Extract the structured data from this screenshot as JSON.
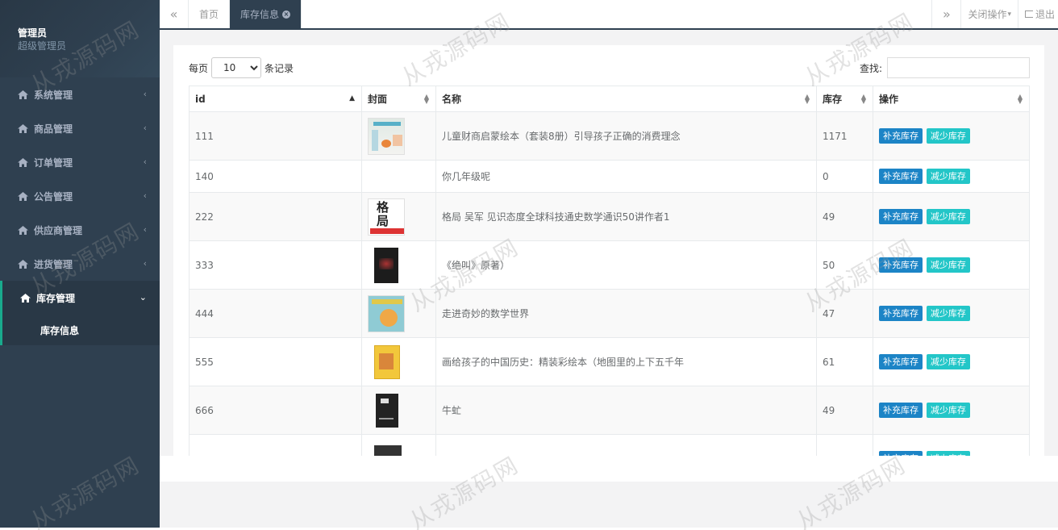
{
  "sidebar": {
    "user_name": "管理员",
    "user_role": "超级管理员",
    "menu": [
      {
        "label": "系统管理",
        "chevron": "‹"
      },
      {
        "label": "商品管理",
        "chevron": "‹"
      },
      {
        "label": "订单管理",
        "chevron": "‹"
      },
      {
        "label": "公告管理",
        "chevron": "‹"
      },
      {
        "label": "供应商管理",
        "chevron": "‹"
      },
      {
        "label": "进货管理",
        "chevron": "‹"
      }
    ],
    "active_menu": {
      "label": "库存管理",
      "chevron": "⌄",
      "sub_item": "库存信息"
    }
  },
  "topbar": {
    "back_icon": "«",
    "forward_icon": "»",
    "tabs": [
      {
        "label": "首页"
      },
      {
        "label": "库存信息",
        "close": "×"
      }
    ],
    "close_ops_label": "关闭操作",
    "close_ops_caret": "▾",
    "logout_label": "退出"
  },
  "toolbar": {
    "per_page_prefix": "每页",
    "per_page_value": "10",
    "per_page_suffix": "条记录",
    "search_label": "查找:"
  },
  "table": {
    "headers": [
      "id",
      "封面",
      "名称",
      "库存",
      "操作"
    ],
    "sort_asc": "▲",
    "sort_both": "▲▼",
    "action_add": "补充库存",
    "action_reduce": "减少库存",
    "rows": [
      {
        "id": "111",
        "name": "儿童财商启蒙绘本（套装8册）引导孩子正确的消费理念",
        "stock": "1171"
      },
      {
        "id": "140",
        "name": "你几年级呢",
        "stock": "0"
      },
      {
        "id": "222",
        "name": "格局 吴军 见识态度全球科技通史数学通识50讲作者1",
        "stock": "49",
        "cover_text": "格局"
      },
      {
        "id": "333",
        "name": "《绝叫》原著）",
        "stock": "50"
      },
      {
        "id": "444",
        "name": "走进奇妙的数学世界",
        "stock": "47"
      },
      {
        "id": "555",
        "name": "画给孩子的中国历史：精装彩绘本（地图里的上下五千年",
        "stock": "61"
      },
      {
        "id": "666",
        "name": "牛虻",
        "stock": "49"
      },
      {
        "id": "",
        "name": "",
        "stock": ""
      }
    ]
  },
  "watermark": "从戎源码网",
  "colors": {
    "sidebar_bg": "#2f4050",
    "accent": "#19aa8d",
    "btn_blue": "#1c84c6",
    "btn_cyan": "#23c6c8"
  }
}
